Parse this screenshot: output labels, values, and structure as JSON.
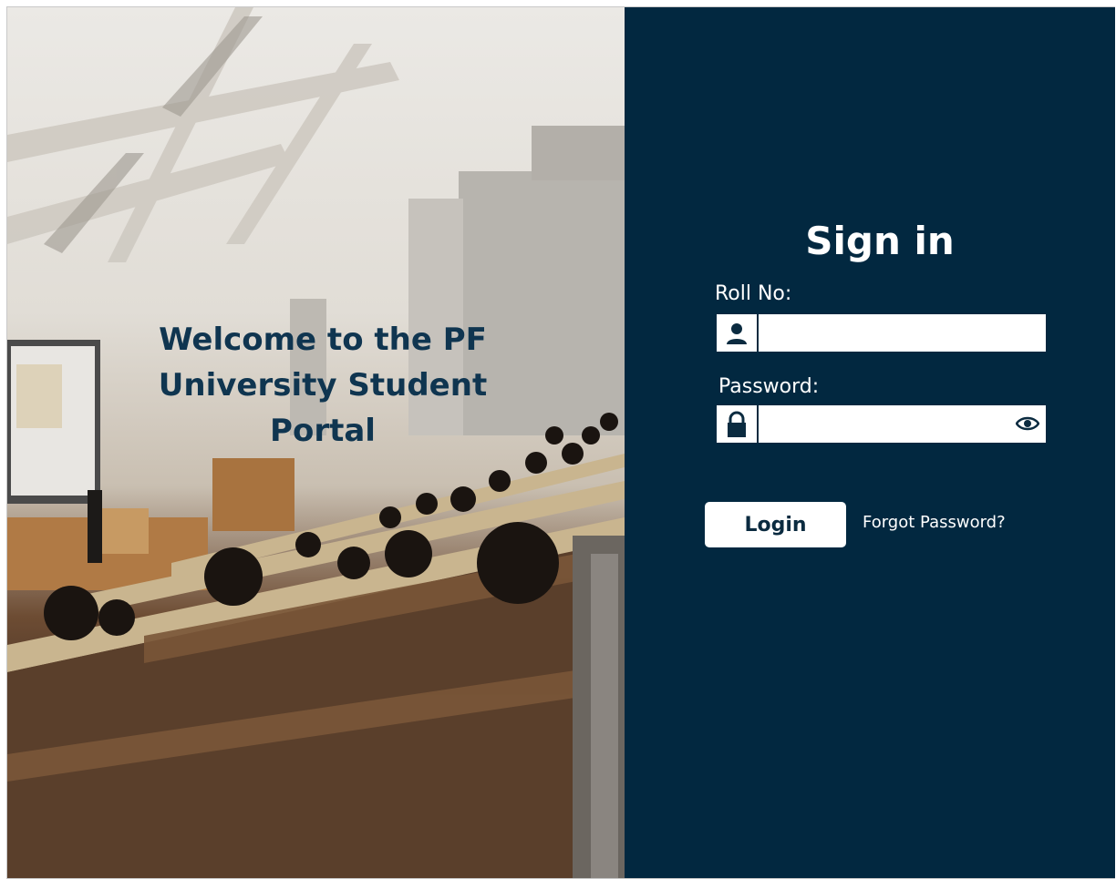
{
  "welcome": {
    "heading": "Welcome to the PF University Student Portal"
  },
  "signin": {
    "title": "Sign in",
    "roll_no": {
      "label": "Roll No:",
      "value": "",
      "icon": "user-icon"
    },
    "password": {
      "label": "Password:",
      "value": "",
      "icon": "lock-icon",
      "toggle_icon": "eye-icon"
    },
    "login_label": "Login",
    "forgot_label": "Forgot Password?"
  },
  "colors": {
    "panel_background": "#022840",
    "heading_color": "#0f3550",
    "button_background": "#ffffff",
    "button_text": "#0b2b40"
  }
}
